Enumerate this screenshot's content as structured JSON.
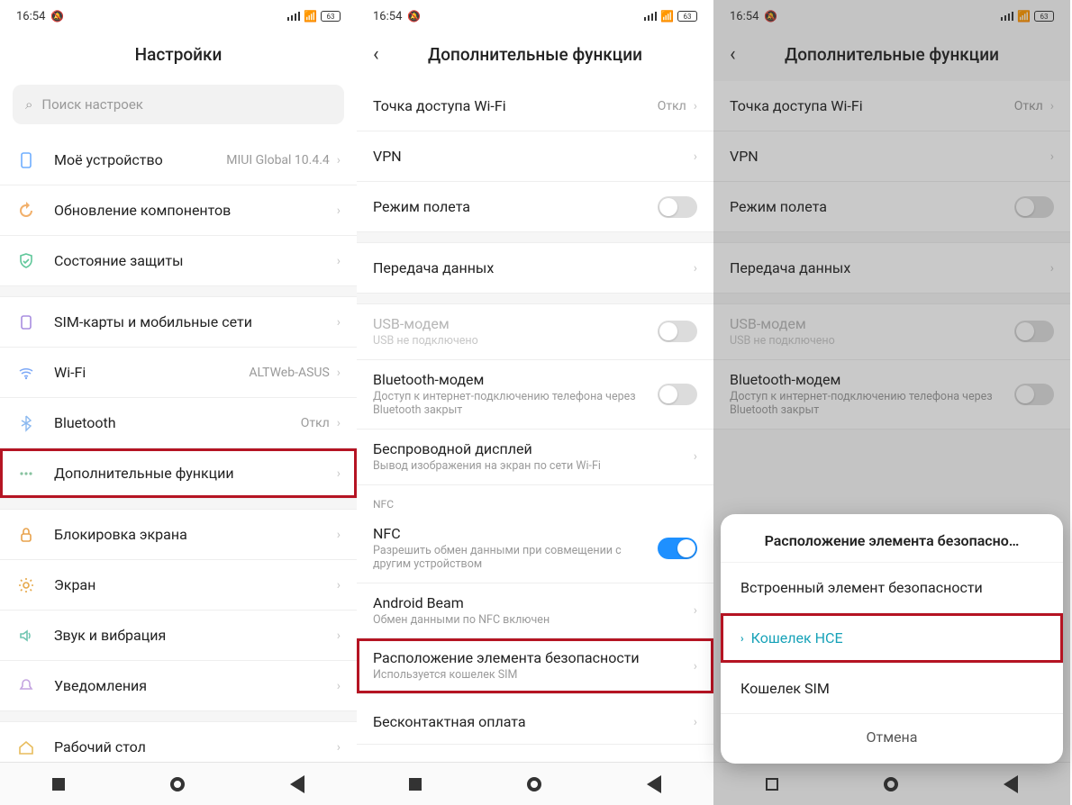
{
  "status": {
    "time": "16:54",
    "battery": "63"
  },
  "screen1": {
    "title": "Настройки",
    "search_placeholder": "Поиск настроек",
    "items": [
      {
        "icon": "device",
        "label": "Моё устройство",
        "value": "MIUI Global 10.4.4"
      },
      {
        "icon": "update",
        "label": "Обновление компонентов"
      },
      {
        "icon": "shield",
        "label": "Состояние защиты"
      },
      {
        "gap": true
      },
      {
        "icon": "sim",
        "label": "SIM-карты и мобильные сети"
      },
      {
        "icon": "wifi",
        "label": "Wi-Fi",
        "value": "ALTWeb-ASUS"
      },
      {
        "icon": "bluetooth",
        "label": "Bluetooth",
        "value": "Откл"
      },
      {
        "icon": "dots",
        "label": "Дополнительные функции",
        "highlight": true
      },
      {
        "gap": true
      },
      {
        "icon": "lock",
        "label": "Блокировка экрана"
      },
      {
        "icon": "brightness",
        "label": "Экран"
      },
      {
        "icon": "sound",
        "label": "Звук и вибрация"
      },
      {
        "icon": "bell",
        "label": "Уведомления"
      },
      {
        "gap": true
      },
      {
        "icon": "home",
        "label": "Рабочий стол"
      }
    ]
  },
  "screen2": {
    "title": "Дополнительные функции",
    "items": [
      {
        "label": "Точка доступа Wi-Fi",
        "value": "Откл"
      },
      {
        "label": "VPN"
      },
      {
        "label": "Режим полета",
        "toggle": "off"
      },
      {
        "gap": true
      },
      {
        "label": "Передача данных"
      },
      {
        "gap": true
      },
      {
        "label": "USB-модем",
        "sub": "USB не подключено",
        "toggle": "off",
        "disabled": true
      },
      {
        "label": "Bluetooth-модем",
        "sub": "Доступ к интернет-подключению телефона через Bluetooth закрыт",
        "toggle": "off"
      },
      {
        "label": "Беспроводной дисплей",
        "sub": "Вывод изображения на экран по сети Wi-Fi"
      },
      {
        "header": "NFC"
      },
      {
        "label": "NFC",
        "sub": "Разрешить обмен данными при совмещении с другим устройством",
        "toggle": "on"
      },
      {
        "label": "Android Beam",
        "sub": "Обмен данными по NFC включен"
      },
      {
        "label": "Расположение элемента безопасности",
        "sub": "Используется кошелек SIM",
        "highlight": true
      },
      {
        "label": "Бесконтактная оплата",
        "cut": true
      }
    ]
  },
  "screen3": {
    "title": "Дополнительные функции",
    "sheet": {
      "title": "Расположение элемента безопасно…",
      "options": [
        {
          "label": "Встроенный элемент безопасности"
        },
        {
          "label": "Кошелек HCE",
          "selected": true,
          "highlight": true
        },
        {
          "label": "Кошелек SIM"
        }
      ],
      "cancel": "Отмена"
    }
  },
  "icons": {
    "device": "▭",
    "update": "⟳",
    "shield": "✔",
    "sim": "▤",
    "wifi": "📶",
    "bluetooth": "ᛒ",
    "dots": "⋯",
    "lock": "🔒",
    "brightness": "☀",
    "sound": "🔊",
    "bell": "🔔",
    "home": "⌂",
    "search": "🔍"
  }
}
